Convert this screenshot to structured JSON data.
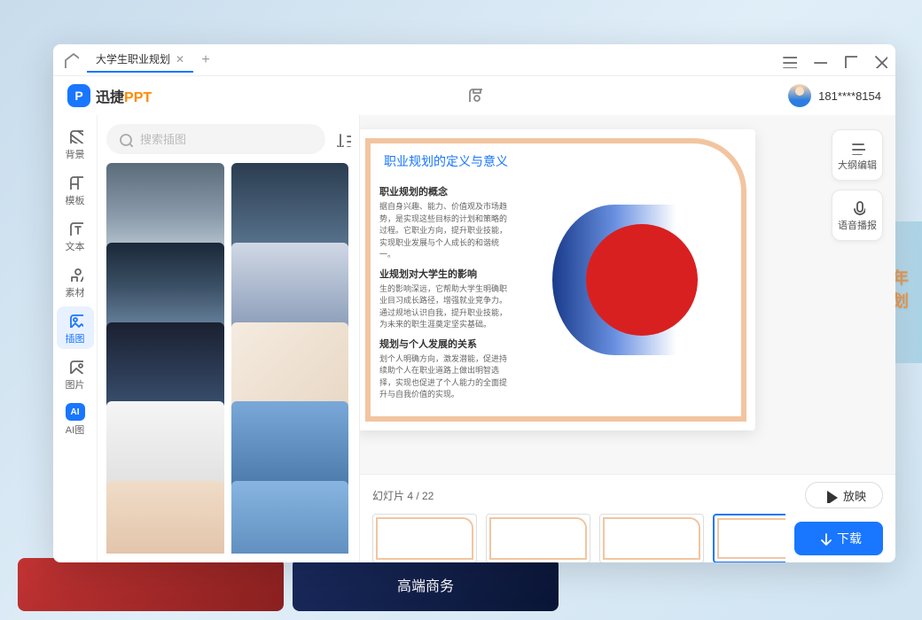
{
  "titlebar": {
    "tab": "大学生职业规划"
  },
  "brand": {
    "name_a": "迅捷",
    "name_b": "PPT",
    "phone": "181****8154"
  },
  "rail": {
    "items": [
      {
        "id": "bg",
        "label": "背景"
      },
      {
        "id": "tpl",
        "label": "模板"
      },
      {
        "id": "text",
        "label": "文本"
      },
      {
        "id": "asset",
        "label": "素材"
      },
      {
        "id": "illus",
        "label": "插图"
      },
      {
        "id": "image",
        "label": "图片"
      },
      {
        "id": "ai",
        "label": "AI图"
      }
    ],
    "active": "illus"
  },
  "search": {
    "placeholder": "搜索插图"
  },
  "slide": {
    "title": "职业规划的定义与意义",
    "sec1_h": "职业规划的概念",
    "sec1_p": "据自身兴趣、能力、价值观及市场趋势，是实现这些目标的计划和策略的过程。它职业方向，提升职业技能，实现职业发展与个人成长的和谐统一。",
    "sec2_h": "业规划对大学生的影响",
    "sec2_p": "生的影响深远，它帮助大学生明确职业目习成长路径，增强就业竞争力。通过规地认识自我，提升职业技能，为未来的职生涯奠定坚实基础。",
    "sec3_h": "规划与个人发展的关系",
    "sec3_p": "划个人明确方向，激发潜能，促进持续助个人在职业道路上做出明智选择，实现也促进了个人能力的全面提升与自我价值的实现。"
  },
  "tools": {
    "outline": "大纲编辑",
    "voice": "语音播报"
  },
  "footer": {
    "counter": "幻灯片 4 / 22",
    "play": "放映",
    "download": "下载"
  },
  "bg": {
    "line1": "公司年",
    "line2": "作计划",
    "bottom": "高端商务"
  }
}
